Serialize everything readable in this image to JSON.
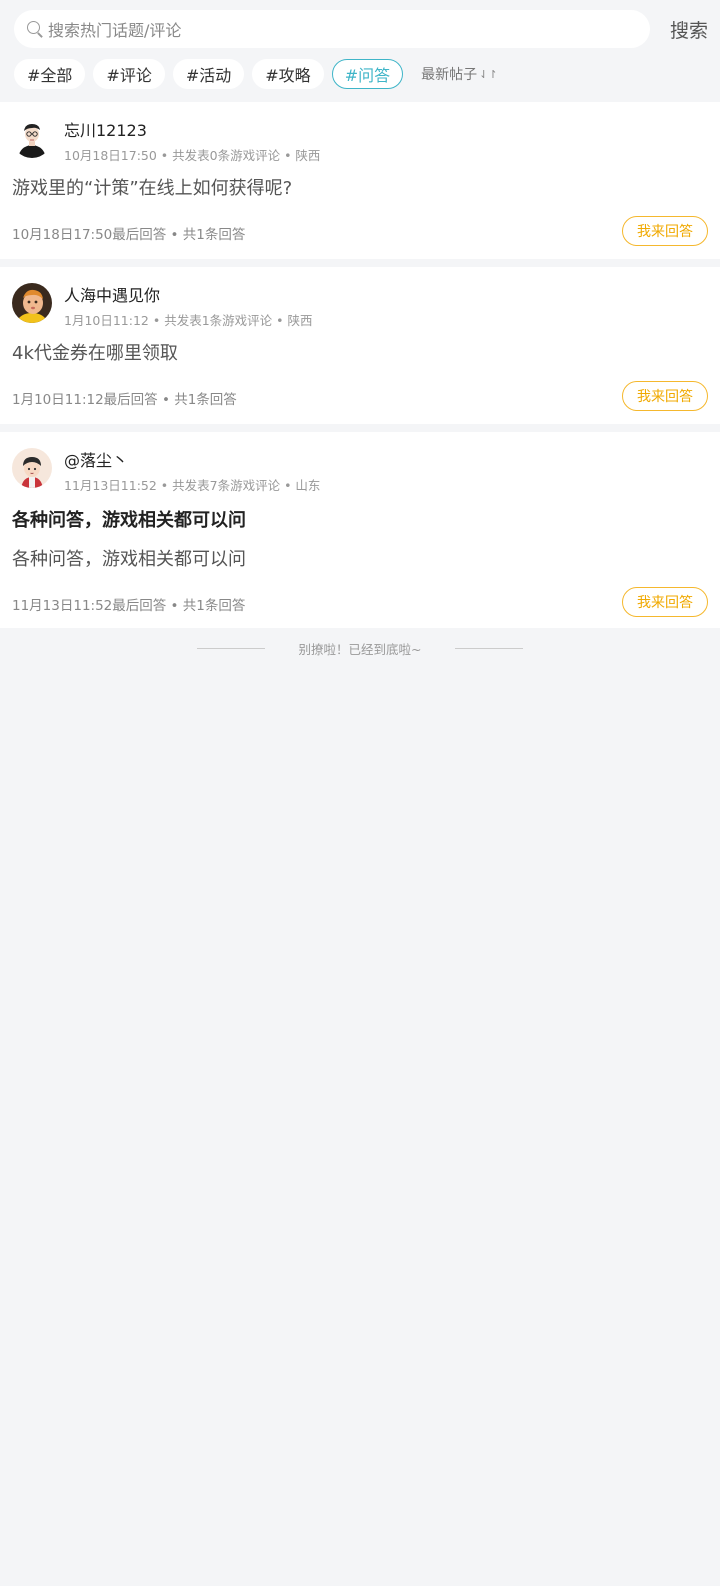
{
  "search": {
    "placeholder": "搜索热门话题/评论",
    "button_label": "搜索"
  },
  "tags": [
    {
      "label": "#全部",
      "active": false
    },
    {
      "label": "#评论",
      "active": false
    },
    {
      "label": "#活动",
      "active": false
    },
    {
      "label": "#攻略",
      "active": false
    },
    {
      "label": "#问答",
      "active": true
    }
  ],
  "sort": {
    "label": "最新帖子",
    "icon": "sort-arrows-icon"
  },
  "posts": [
    {
      "username": "忘川12123",
      "meta": "10月18日17:50 • 共发表0条游戏评论 • 陕西",
      "title": "",
      "body": "游戏里的“计策”在线上如何获得呢?",
      "footer": "10月18日17:50最后回答 • 共1条回答",
      "answer_label": "我来回答"
    },
    {
      "username": "人海中遇见你",
      "meta": "1月10日11:12 • 共发表1条游戏评论 • 陕西",
      "title": "",
      "body": "4k代金券在哪里领取",
      "footer": "1月10日11:12最后回答 • 共1条回答",
      "answer_label": "我来回答"
    },
    {
      "username": "@落尘丶",
      "meta": "11月13日11:52 • 共发表7条游戏评论 • 山东",
      "title": "各种问答，游戏相关都可以问",
      "body": "各种问答，游戏相关都可以问",
      "footer": "11月13日11:52最后回答 • 共1条回答",
      "answer_label": "我来回答"
    }
  ],
  "end_text": "别撩啦！已经到底啦~",
  "colors": {
    "active_tag": "#3fb5c8",
    "answer_button": "#f0a900",
    "background": "#f4f5f7"
  }
}
